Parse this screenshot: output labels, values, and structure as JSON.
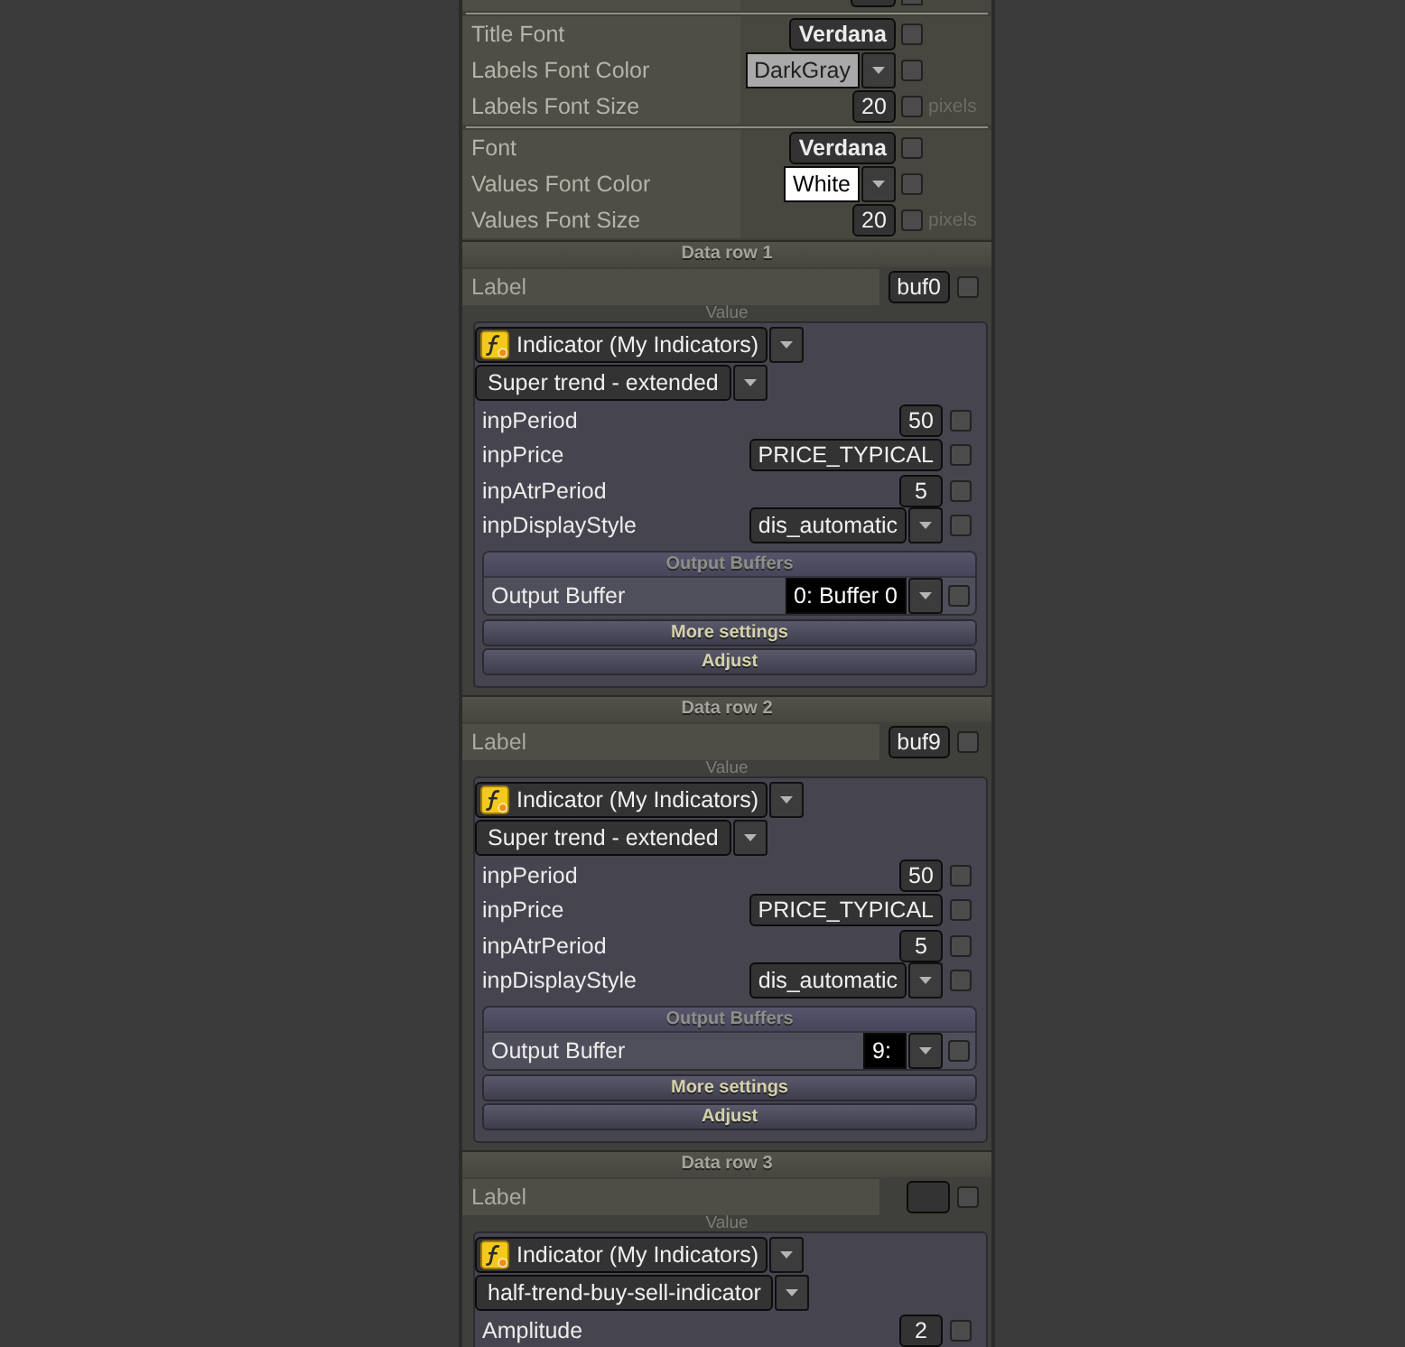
{
  "partial_row": {
    "checked": false
  },
  "settings_groups": [
    {
      "rows": [
        {
          "label": "Title Font",
          "kind": "font",
          "value": "Verdana",
          "checked": false
        },
        {
          "label": "Labels Font Color",
          "kind": "color",
          "value": "DarkGray",
          "color": "#a9a9a9",
          "checked": false
        },
        {
          "label": "Labels Font Size",
          "kind": "number",
          "value": "20",
          "checked": false,
          "unit": "pixels"
        }
      ]
    },
    {
      "rows": [
        {
          "label": "Font",
          "kind": "font",
          "value": "Verdana",
          "checked": false
        },
        {
          "label": "Values Font Color",
          "kind": "color",
          "value": "White",
          "color": "#ffffff",
          "checked": false
        },
        {
          "label": "Values Font Size",
          "kind": "number",
          "value": "20",
          "checked": false,
          "unit": "pixels"
        }
      ]
    }
  ],
  "data_rows": [
    {
      "title": "Data row 1",
      "label": {
        "caption": "Label",
        "value": "buf0",
        "checked": false
      },
      "value_caption": "Value",
      "source": "Indicator (My Indicators)",
      "indicator": "Super trend - extended",
      "params": [
        {
          "name": "inpPeriod",
          "kind": "number",
          "value": "50",
          "checked": false
        },
        {
          "name": "inpPrice",
          "kind": "text",
          "value": "PRICE_TYPICAL",
          "checked": false
        },
        {
          "name": "inpAtrPeriod",
          "kind": "number",
          "value": "5",
          "checked": false
        },
        {
          "name": "inpDisplayStyle",
          "kind": "choice",
          "value": "dis_automatic",
          "checked": false
        }
      ],
      "output_buffers": {
        "title": "Output Buffers",
        "rows": [
          {
            "label": "Output Buffer",
            "value": "0: Buffer 0",
            "checked": false
          }
        ]
      },
      "buttons": [
        "More settings",
        "Adjust"
      ]
    },
    {
      "title": "Data row 2",
      "label": {
        "caption": "Label",
        "value": "buf9",
        "checked": false
      },
      "value_caption": "Value",
      "source": "Indicator (My Indicators)",
      "indicator": "Super trend - extended",
      "params": [
        {
          "name": "inpPeriod",
          "kind": "number",
          "value": "50",
          "checked": false
        },
        {
          "name": "inpPrice",
          "kind": "text",
          "value": "PRICE_TYPICAL",
          "checked": false
        },
        {
          "name": "inpAtrPeriod",
          "kind": "number",
          "value": "5",
          "checked": false
        },
        {
          "name": "inpDisplayStyle",
          "kind": "choice",
          "value": "dis_automatic",
          "checked": false
        }
      ],
      "output_buffers": {
        "title": "Output Buffers",
        "rows": [
          {
            "label": "Output Buffer",
            "value": "9:",
            "checked": false
          }
        ]
      },
      "buttons": [
        "More settings",
        "Adjust"
      ]
    },
    {
      "title": "Data row 3",
      "label": {
        "caption": "Label",
        "checked": false
      },
      "value_caption": "Value",
      "source": "Indicator (My Indicators)",
      "indicator": "half-trend-buy-sell-indicator",
      "params": [
        {
          "name": "Amplitude",
          "kind": "number",
          "value": "2",
          "checked": false
        }
      ]
    }
  ]
}
